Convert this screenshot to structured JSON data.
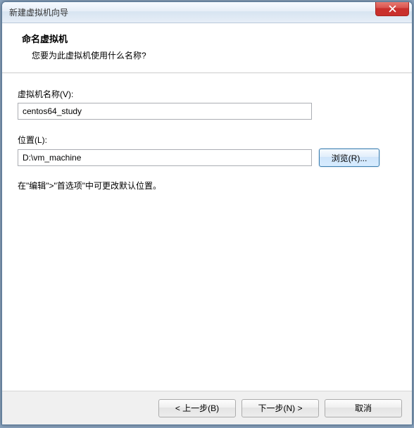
{
  "titlebar": {
    "text": "新建虚拟机向导"
  },
  "header": {
    "title": "命名虚拟机",
    "subtitle": "您要为此虚拟机使用什么名称?"
  },
  "fields": {
    "name_label": "虚拟机名称(V):",
    "name_value": "centos64_study",
    "location_label": "位置(L):",
    "location_value": "D:\\vm_machine",
    "browse_label": "浏览(R)..."
  },
  "hint": "在\"编辑\">\"首选项\"中可更改默认位置。",
  "footer": {
    "back": "< 上一步(B)",
    "next": "下一步(N) >",
    "cancel": "取消"
  }
}
